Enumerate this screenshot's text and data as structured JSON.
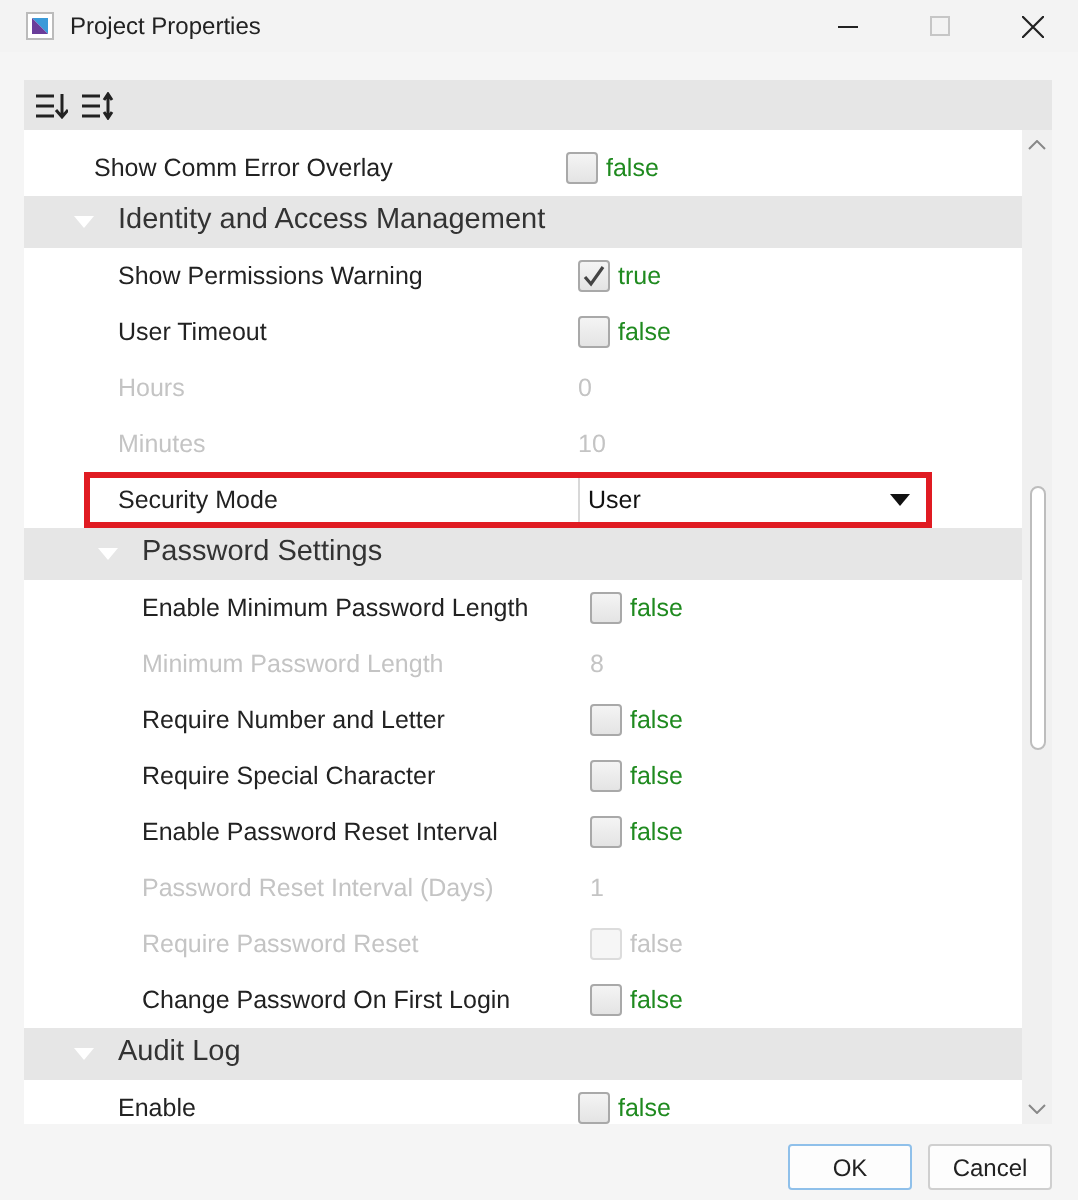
{
  "window": {
    "title": "Project Properties"
  },
  "properties": [
    {
      "kind": "bool",
      "label": "Show Comm Error Overlay",
      "value": "false",
      "checked": false,
      "disabled": false
    },
    {
      "kind": "group",
      "label": "Identity and Access Management",
      "expanded": true,
      "children": [
        {
          "kind": "bool",
          "label": "Show Permissions Warning",
          "value": "true",
          "checked": true,
          "disabled": false
        },
        {
          "kind": "bool",
          "label": "User Timeout",
          "value": "false",
          "checked": false,
          "disabled": false
        },
        {
          "kind": "text",
          "label": "Hours",
          "value": "0",
          "disabled": true
        },
        {
          "kind": "text",
          "label": "Minutes",
          "value": "10",
          "disabled": true
        },
        {
          "kind": "choice",
          "label": "Security Mode",
          "value": "User",
          "disabled": false,
          "highlighted": true
        },
        {
          "kind": "group",
          "label": "Password Settings",
          "expanded": true,
          "children": [
            {
              "kind": "bool",
              "label": "Enable Minimum Password Length",
              "value": "false",
              "checked": false,
              "disabled": false
            },
            {
              "kind": "text",
              "label": "Minimum Password Length",
              "value": "8",
              "disabled": true
            },
            {
              "kind": "bool",
              "label": "Require Number and Letter",
              "value": "false",
              "checked": false,
              "disabled": false
            },
            {
              "kind": "bool",
              "label": "Require Special Character",
              "value": "false",
              "checked": false,
              "disabled": false
            },
            {
              "kind": "bool",
              "label": "Enable Password Reset Interval",
              "value": "false",
              "checked": false,
              "disabled": false
            },
            {
              "kind": "text",
              "label": "Password Reset Interval (Days)",
              "value": "1",
              "disabled": true
            },
            {
              "kind": "bool",
              "label": "Require Password Reset",
              "value": "false",
              "checked": false,
              "disabled": true
            },
            {
              "kind": "bool",
              "label": "Change Password On First Login",
              "value": "false",
              "checked": false,
              "disabled": false
            }
          ]
        }
      ]
    },
    {
      "kind": "group",
      "label": "Audit Log",
      "expanded": true,
      "children": [
        {
          "kind": "bool",
          "label": "Enable",
          "value": "false",
          "checked": false,
          "disabled": false
        }
      ]
    }
  ],
  "buttons": [
    {
      "label": "OK",
      "default": true
    },
    {
      "label": "Cancel",
      "default": false
    }
  ]
}
